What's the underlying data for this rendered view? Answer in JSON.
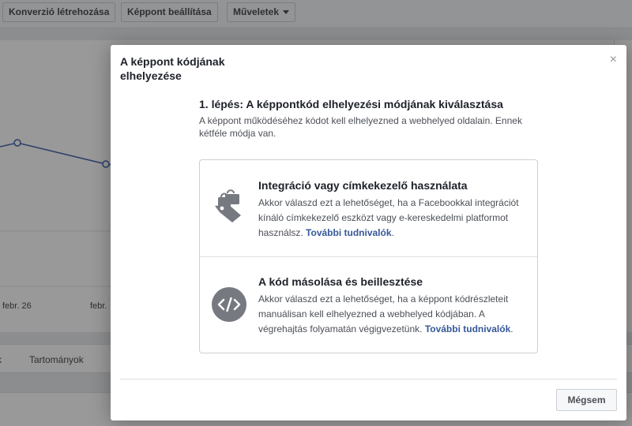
{
  "toolbar": {
    "create_conversion_label": "Konverzió létrehozása",
    "pixel_settings_label": "Képpont beállítása",
    "actions_label": "Műveletek"
  },
  "background": {
    "chart": {
      "x_ticks": [
        "febr. 26",
        "febr."
      ]
    },
    "tabs": [
      "k",
      "Tartományok"
    ]
  },
  "modal": {
    "title": "A képpont kódjának elhelyezése",
    "close_symbol": "×",
    "step_title": "1. lépés: A képpontkód elhelyezési módjának kiválasztása",
    "step_description": "A képpont működéséhez kódot kell elhelyezned a webhelyed oldalain. Ennek kétféle módja van.",
    "options": [
      {
        "icon": "shopping-bag-tag-icon",
        "title": "Integráció vagy címkekezelő használata",
        "description": "Akkor válaszd ezt a lehetőséget, ha a Facebookkal integrációt kínáló címkekezelő eszközt vagy e-kereskedelmi platformot használsz.",
        "link": "További tudnivalók"
      },
      {
        "icon": "code-icon",
        "title": "A kód másolása és beillesztése",
        "description": "Akkor válaszd ezt a lehetőséget, ha a képpont kódrészleteit manuálisan kell elhelyezned a webhelyed kódjában. A végrehajtás folyamatán végigvezetünk.",
        "link": "További tudnivalók"
      }
    ],
    "cancel_label": "Mégsem"
  },
  "colors": {
    "accent_link": "#365899",
    "icon_gray": "#767a80",
    "chart_line": "#4a67b0"
  }
}
